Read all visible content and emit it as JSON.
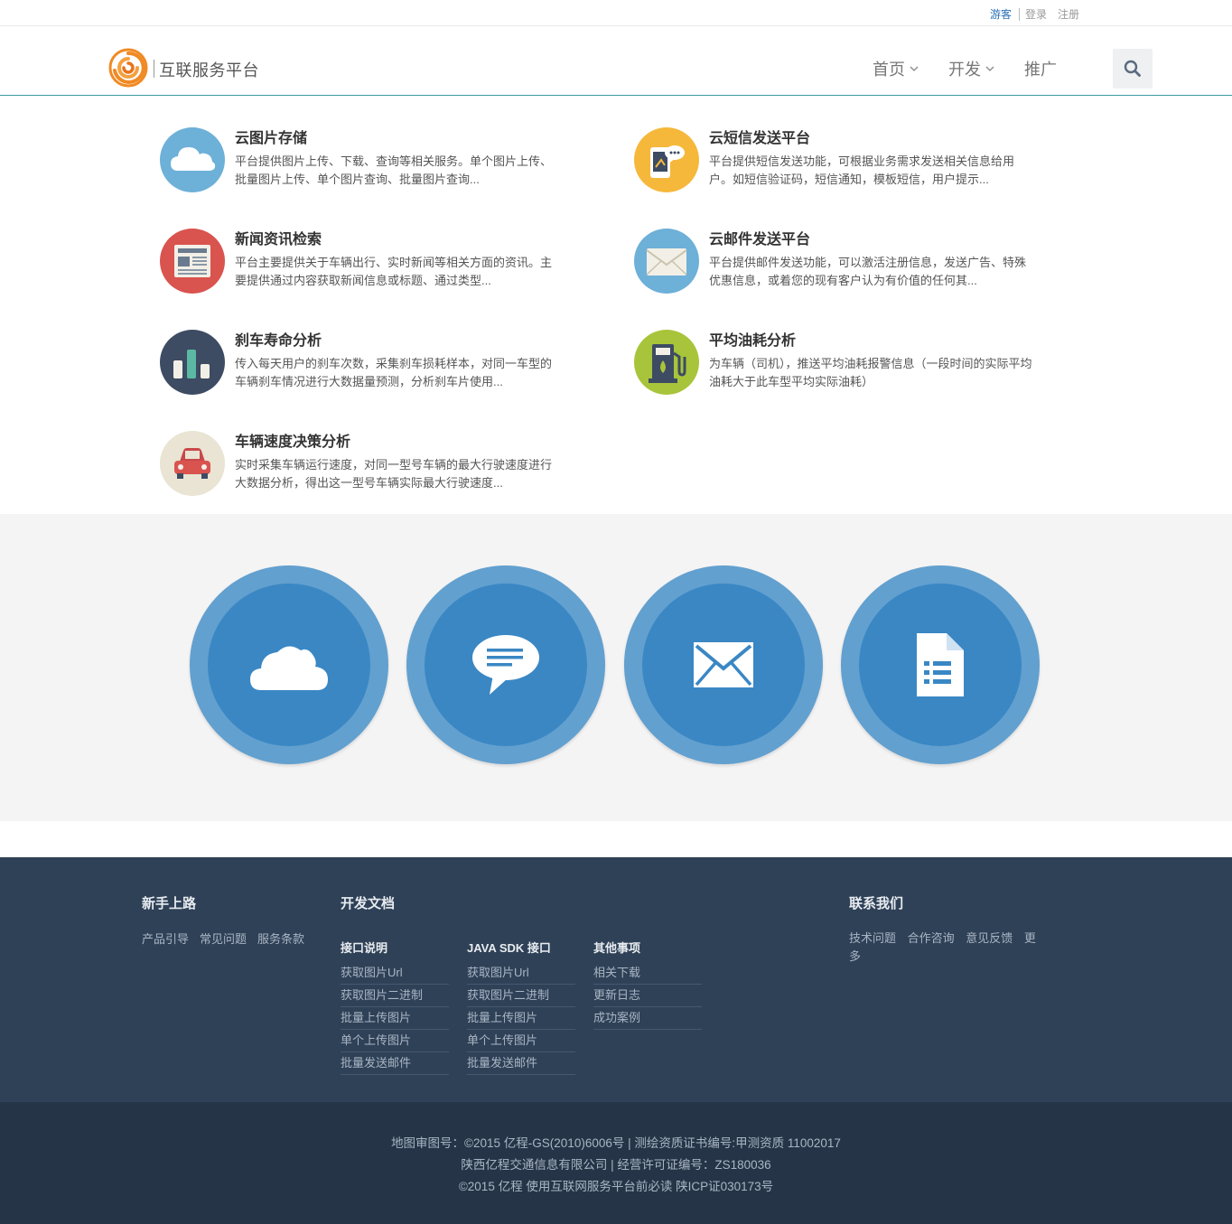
{
  "topbar": {
    "guest": "游客",
    "login": "登录",
    "register": "注册"
  },
  "header": {
    "brand": "互联服务平台",
    "nav": [
      {
        "label": "首页",
        "dropdown": true
      },
      {
        "label": "开发",
        "dropdown": true
      },
      {
        "label": "推广",
        "dropdown": false
      }
    ],
    "search_icon": "search-icon"
  },
  "services": [
    {
      "title": "云图片存储",
      "desc": "平台提供图片上传、下载、查询等相关服务。单个图片上传、批量图片上传、单个图片查询、批量图片查询...",
      "icon": "cloud-icon",
      "color": "#6db0d8"
    },
    {
      "title": "云短信发送平台",
      "desc": "平台提供短信发送功能，可根据业务需求发送相关信息给用户。如短信验证码，短信通知，模板短信，用户提示...",
      "icon": "phone-message-icon",
      "color": "#f6b83b"
    },
    {
      "title": "新闻资讯检索",
      "desc": "平台主要提供关于车辆出行、实时新闻等相关方面的资讯。主要提供通过内容获取新闻信息或标题、通过类型...",
      "icon": "newspaper-icon",
      "color": "#d9534f"
    },
    {
      "title": "云邮件发送平台",
      "desc": "平台提供邮件发送功能，可以激活注册信息，发送广告、特殊优惠信息，或着您的现有客户认为有价值的任何其...",
      "icon": "envelope-icon",
      "color": "#6db0d8"
    },
    {
      "title": "刹车寿命分析",
      "desc": "传入每天用户的刹车次数，采集刹车损耗样本，对同一车型的车辆刹车情况进行大数据量预测，分析刹车片使用...",
      "icon": "bar-chart-icon",
      "color": "#3d4b63"
    },
    {
      "title": "平均油耗分析",
      "desc": "为车辆（司机），推送平均油耗报警信息（一段时间的实际平均油耗大于此车型平均实际油耗）",
      "icon": "fuel-pump-icon",
      "color": "#a8c43a"
    },
    {
      "title": "车辆速度决策分析",
      "desc": "实时采集车辆运行速度，对同一型号车辆的最大行驶速度进行大数据分析，得出这一型号车辆实际最大行驶速度...",
      "icon": "car-icon",
      "color": "#e9e4d3"
    }
  ],
  "features": [
    {
      "icon": "cloud-icon"
    },
    {
      "icon": "chat-bubble-icon"
    },
    {
      "icon": "envelope-icon"
    },
    {
      "icon": "document-icon"
    }
  ],
  "footer": {
    "getting_started": {
      "title": "新手上路",
      "links": [
        "产品引导",
        "常见问题",
        "服务条款"
      ]
    },
    "docs": {
      "title": "开发文档",
      "columns": [
        {
          "title": "接口说明",
          "items": [
            "获取图片Url",
            "获取图片二进制",
            "批量上传图片",
            "单个上传图片",
            "批量发送邮件"
          ]
        },
        {
          "title": "JAVA SDK 接口",
          "items": [
            "获取图片Url",
            "获取图片二进制",
            "批量上传图片",
            "单个上传图片",
            "批量发送邮件"
          ]
        },
        {
          "title": "其他事项",
          "items": [
            "相关下载",
            "更新日志",
            "成功案例"
          ]
        }
      ]
    },
    "contact": {
      "title": "联系我们",
      "links": [
        "技术问题",
        "合作咨询",
        "意见反馈",
        "更多"
      ]
    }
  },
  "bottom": {
    "line1": "地图审图号：©2015 亿程-GS(2010)6006号   |   测绘资质证书编号:甲测资质 11002017",
    "line2": "陕西亿程交通信息有限公司 | 经营许可证编号：ZS180036",
    "line3": "©2015 亿程 使用互联网服务平台前必读 陕ICP证030173号"
  }
}
